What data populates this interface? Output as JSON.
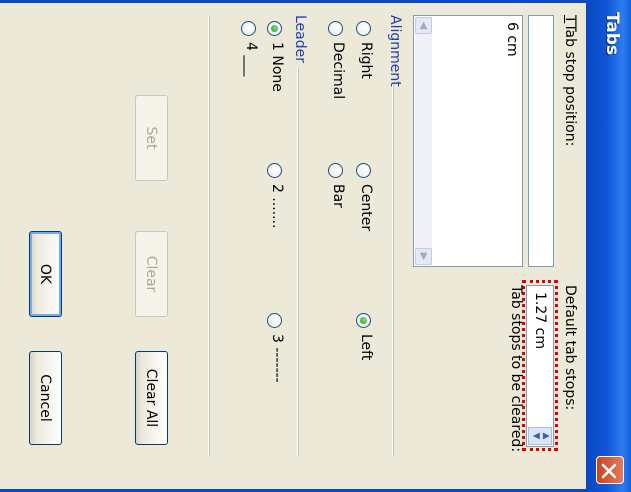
{
  "dialog": {
    "title": "Tabs",
    "close_icon": "close-icon"
  },
  "tab_stop_position": {
    "label": "Tab stop position:",
    "value": "",
    "items": [
      "6 cm"
    ]
  },
  "default_tab_stops": {
    "label": "Default tab stops:",
    "value": "1.27 cm"
  },
  "tab_stops_to_be_cleared": {
    "label": "Tab stops to be cleared:"
  },
  "alignment": {
    "label": "Alignment",
    "options": [
      {
        "label": "Left",
        "selected": true
      },
      {
        "label": "Center",
        "selected": false
      },
      {
        "label": "Right",
        "selected": false
      },
      {
        "label": "Decimal",
        "selected": false
      },
      {
        "label": "Bar",
        "selected": false
      }
    ]
  },
  "leader": {
    "label": "Leader",
    "options": [
      {
        "label": "1 None",
        "selected": true
      },
      {
        "label": "2 .......",
        "selected": false
      },
      {
        "label": "3 -------",
        "selected": false
      },
      {
        "label": "4 ___",
        "selected": false
      }
    ]
  },
  "buttons": {
    "set": "Set",
    "clear": "Clear",
    "clear_all": "Clear All",
    "ok": "OK",
    "cancel": "Cancel"
  },
  "colors": {
    "title_bar": "#0a5fe0",
    "dialog_bg": "#ece9d8",
    "group_label": "#1c3fb8",
    "highlight": "#e00000"
  }
}
